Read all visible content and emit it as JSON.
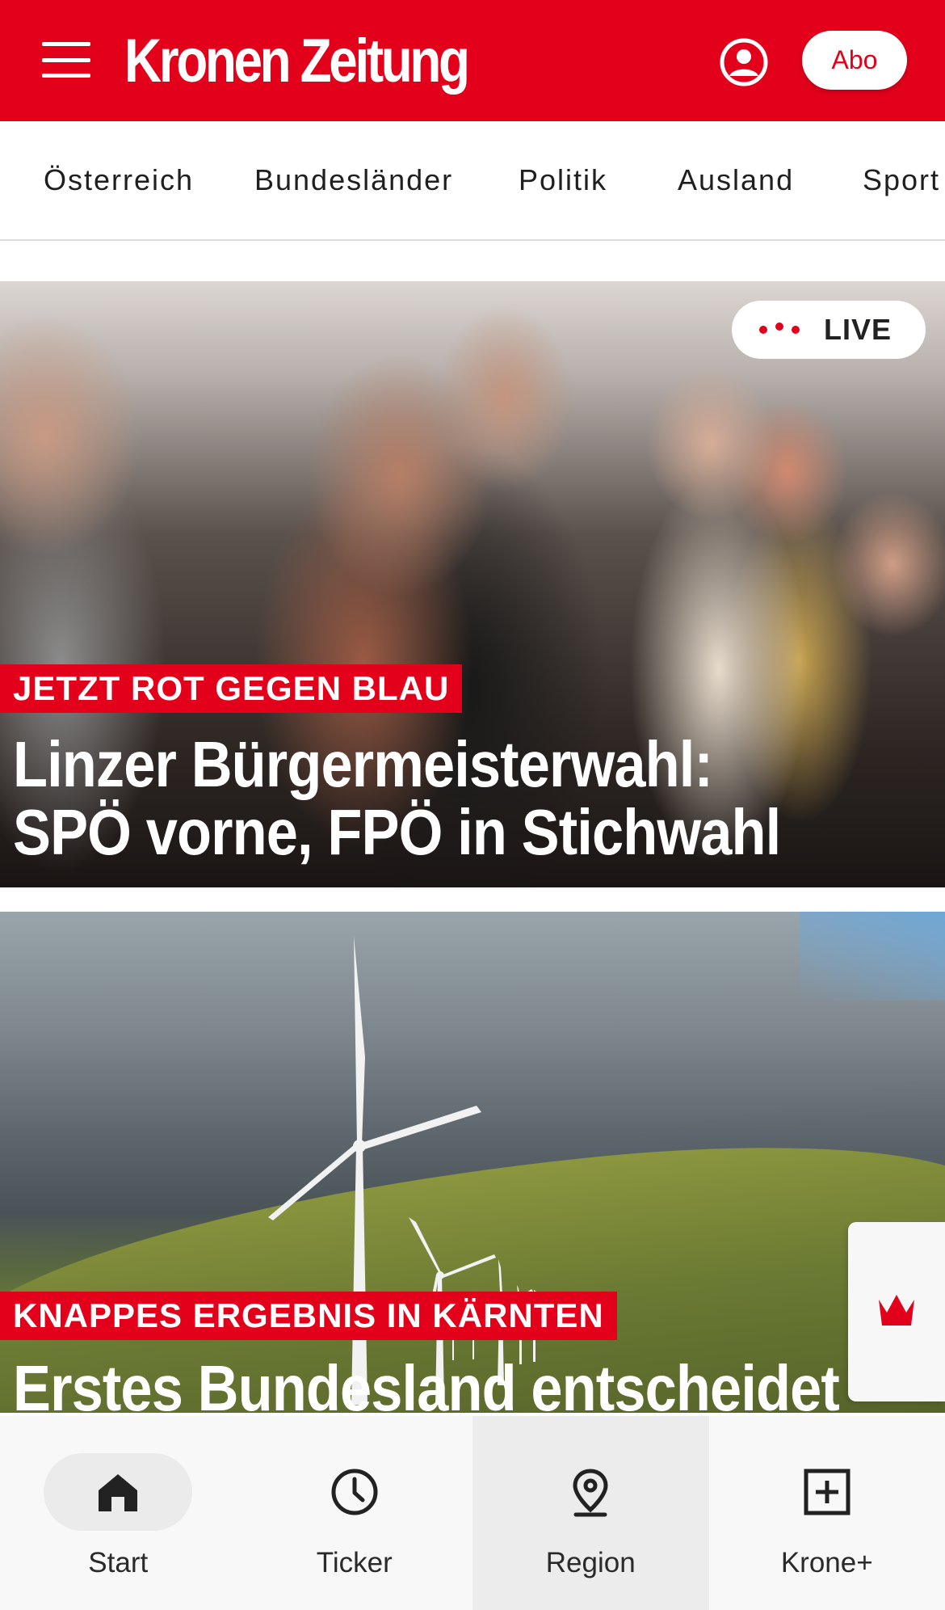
{
  "header": {
    "logo_text": "Kronen Zeitung",
    "abo_label": "Abo",
    "brand_color": "#e2001a",
    "icons": [
      "menu-icon",
      "user-icon"
    ]
  },
  "categories": [
    "Österreich",
    "Bundesländer",
    "Politik",
    "Ausland",
    "Sport"
  ],
  "articles": [
    {
      "kicker": "JETZT ROT GEGEN BLAU",
      "headline_line1": "Linzer Bürgermeisterwahl:",
      "headline_line2": "SPÖ vorne, FPÖ in Stichwahl",
      "badge": "LIVE"
    },
    {
      "kicker": "KNAPPES ERGEBNIS IN KÄRNTEN",
      "headline_line1": "Erstes Bundesland entscheidet"
    }
  ],
  "side_tab": {
    "icon": "crown-icon"
  },
  "bottom_nav": {
    "tabs": [
      {
        "label": "Start",
        "icon": "home-icon",
        "active": true
      },
      {
        "label": "Ticker",
        "icon": "clock-icon"
      },
      {
        "label": "Region",
        "icon": "location-pin-icon"
      },
      {
        "label": "Krone+",
        "icon": "plus-box-icon"
      }
    ]
  }
}
